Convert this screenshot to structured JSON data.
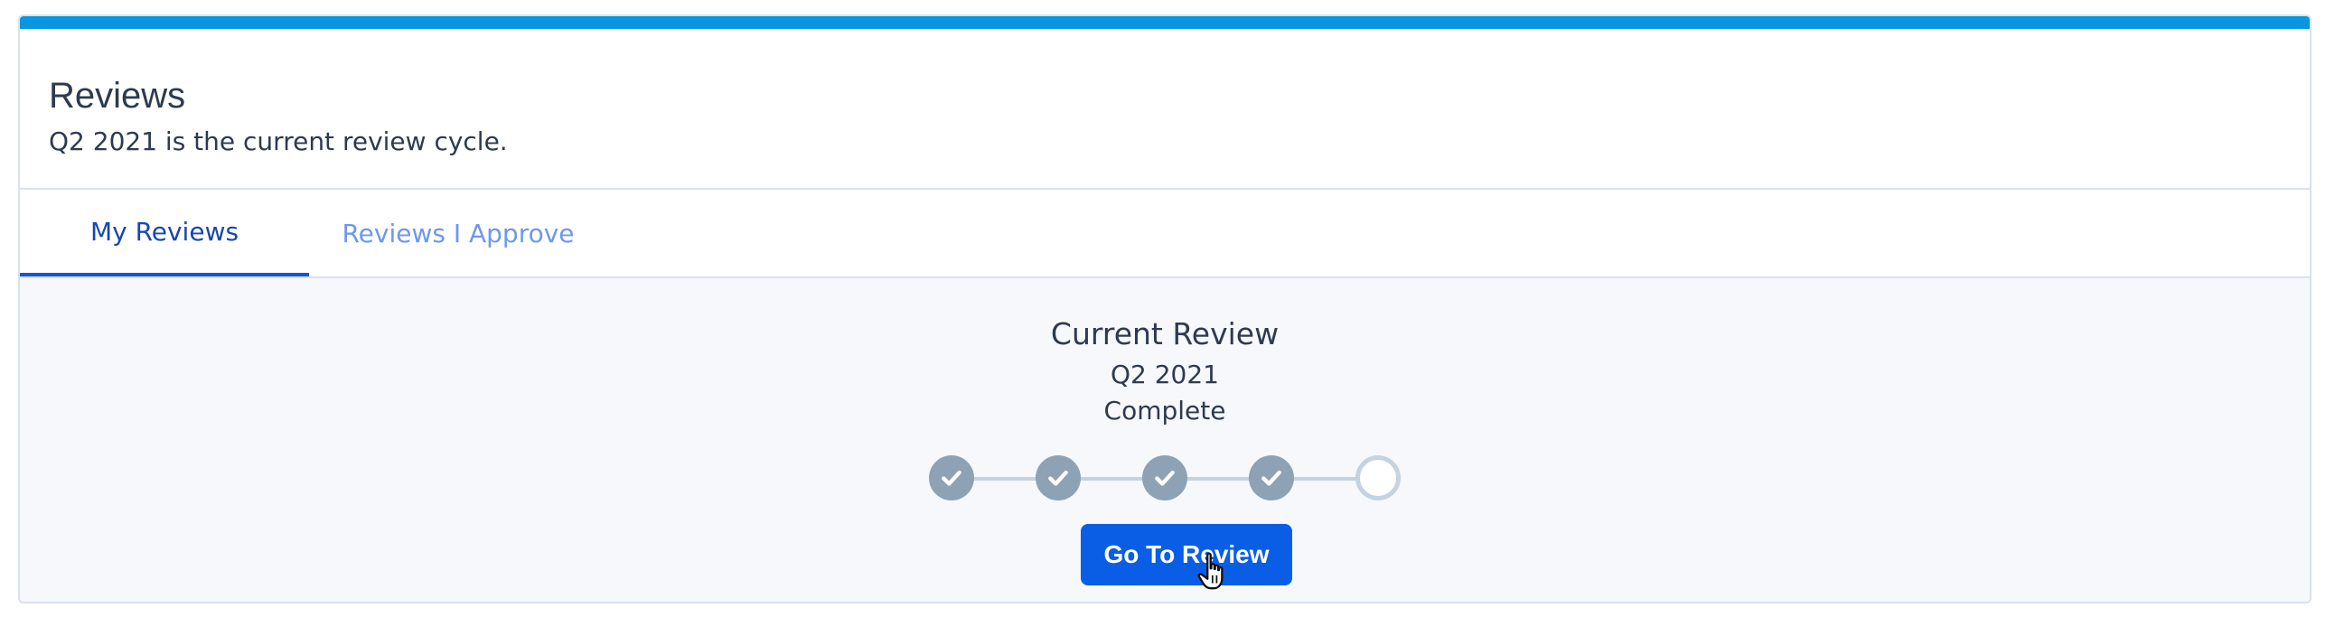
{
  "colors": {
    "accent": "#0a95e0",
    "tab_active": "#1747b0",
    "tab_inactive": "#6d98ee",
    "primary_button": "#0a5ee6",
    "step_done": "#8da2b5",
    "step_pending_border": "#c5d3e0"
  },
  "header": {
    "title": "Reviews",
    "subtitle": "Q2 2021 is the current review cycle."
  },
  "tabs": [
    {
      "label": "My Reviews",
      "active": true
    },
    {
      "label": "Reviews I Approve",
      "active": false
    }
  ],
  "current_review": {
    "heading": "Current Review",
    "cycle": "Q2 2021",
    "status": "Complete",
    "steps": [
      {
        "state": "done",
        "icon": "check-icon"
      },
      {
        "state": "done",
        "icon": "check-icon"
      },
      {
        "state": "done",
        "icon": "check-icon"
      },
      {
        "state": "done",
        "icon": "check-icon"
      },
      {
        "state": "pending",
        "icon": ""
      }
    ],
    "button_label": "Go To Review"
  },
  "pointer": {
    "icon": "hand-pointer-icon"
  }
}
